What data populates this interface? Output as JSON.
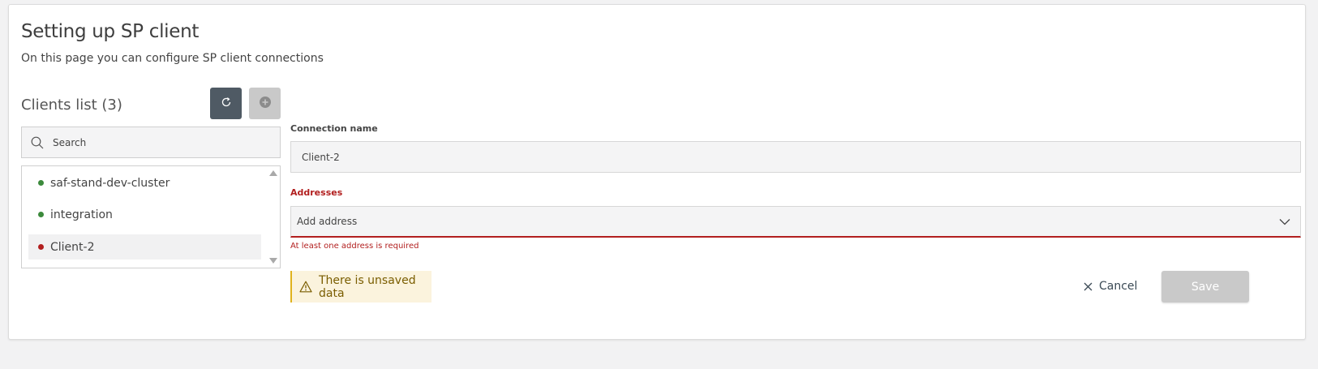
{
  "header": {
    "title": "Setting up SP client",
    "subtitle": "On this page you can configure SP client connections"
  },
  "clients_panel": {
    "title": "Clients list (3)",
    "refresh_icon": "refresh-icon",
    "add_icon": "add-circle-icon",
    "search": {
      "placeholder": "Search",
      "value": ""
    },
    "items": [
      {
        "label": "saf-stand-dev-cluster",
        "status_color": "#3c8a3c",
        "selected": false
      },
      {
        "label": "integration",
        "status_color": "#3c8a3c",
        "selected": false
      },
      {
        "label": "Client-2",
        "status_color": "#b21f1f",
        "selected": true
      }
    ]
  },
  "form": {
    "connection_name": {
      "label": "Connection name",
      "value": "Client-2"
    },
    "addresses": {
      "label": "Addresses",
      "placeholder": "Add address",
      "error": "At least one address is required"
    },
    "warning": "There is unsaved data",
    "cancel_label": "Cancel",
    "save_label": "Save"
  },
  "colors": {
    "accent_dark": "#4f5a64",
    "error": "#b21f1f",
    "success": "#3c8a3c",
    "warning_bg": "#fbf3dd",
    "warning_border": "#e0b21d",
    "disabled": "#c9c9c9"
  }
}
